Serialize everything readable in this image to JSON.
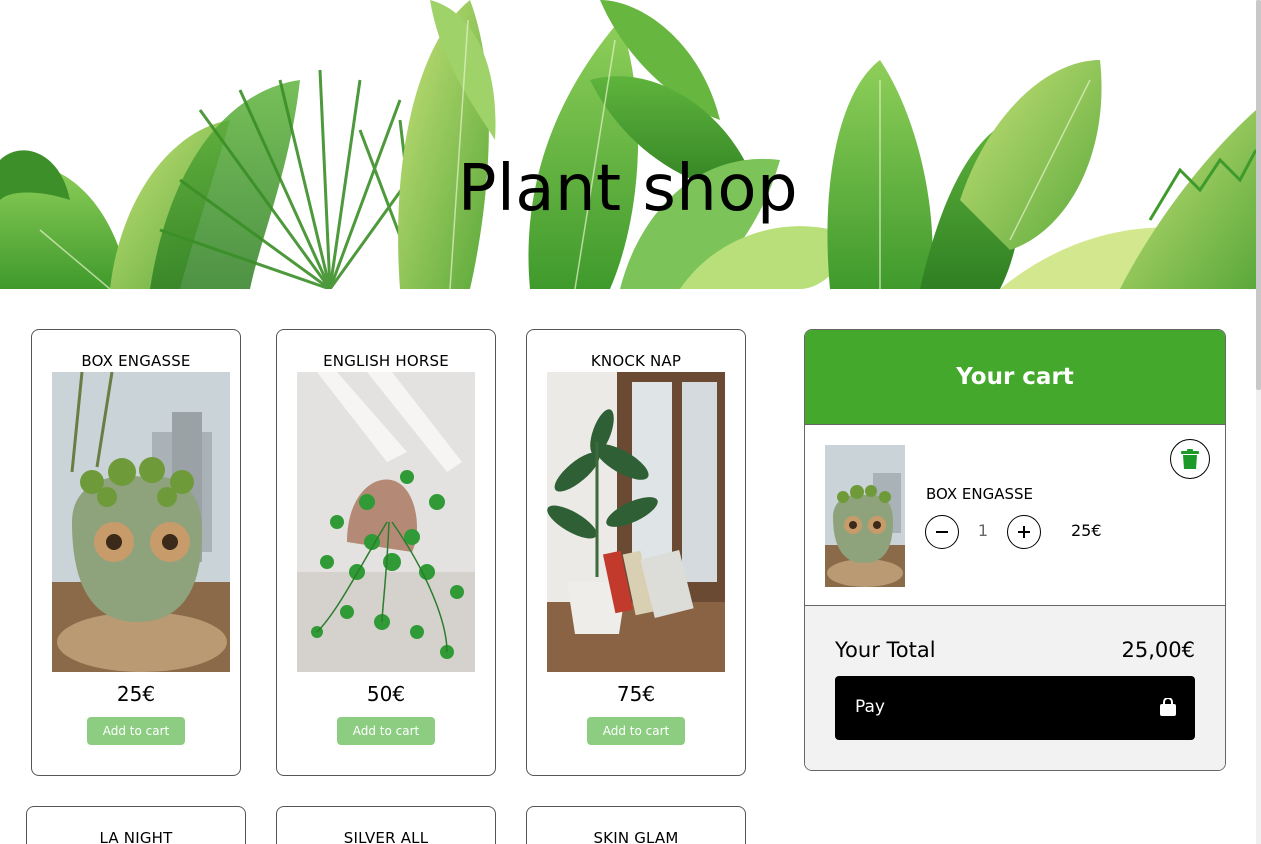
{
  "header": {
    "title": "Plant shop"
  },
  "products": [
    {
      "name": "BOX ENGASSE",
      "price": "25€",
      "button": "Add to cart"
    },
    {
      "name": "ENGLISH HORSE",
      "price": "50€",
      "button": "Add to cart"
    },
    {
      "name": "KNOCK NAP",
      "price": "75€",
      "button": "Add to cart"
    },
    {
      "name": "LA NIGHT"
    },
    {
      "name": "SILVER ALL"
    },
    {
      "name": "SKIN GLAM"
    }
  ],
  "cart": {
    "title": "Your cart",
    "items": [
      {
        "name": "BOX ENGASSE",
        "quantity": "1",
        "price": "25€"
      }
    ],
    "total_label": "Your Total",
    "total_value": "25,00€",
    "pay_label": "Pay"
  },
  "icons": {
    "remove": "trash-icon",
    "decrease": "minus-icon",
    "increase": "plus-icon",
    "pay": "shopping-bag-icon"
  },
  "colors": {
    "accent": "#43a82b",
    "add_button": "#8ccd82",
    "pay_button": "#000000"
  }
}
